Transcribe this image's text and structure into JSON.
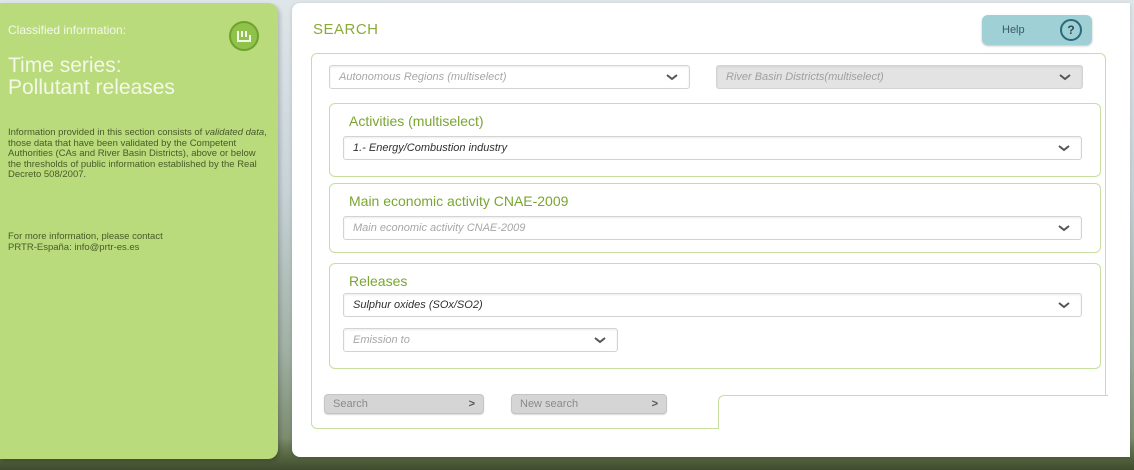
{
  "sidebar": {
    "header": "Classified information:",
    "title_line1": "Time series:",
    "title_line2": "Pollutant releases",
    "info_pre": "Information provided in this section consists of",
    "info_em": "validated data",
    "info_post": ", those data that have been validated by the Competent Authorities (CAs and River Basin Districts), above or below the thresholds of public information established by the Real Decreto 508/2007.",
    "contact_line1": "For more information, please contact",
    "contact_line2": "PRTR-España: info@prtr-es.es"
  },
  "main": {
    "title": "SEARCH",
    "help_label": "Help",
    "help_symbol": "?",
    "regions_placeholder": "Autonomous Regions (multiselect)",
    "basins_placeholder": "River Basin Districts(multiselect)",
    "activities": {
      "title": "Activities (multiselect)",
      "selected": "1.- Energy/Combustion industry"
    },
    "cnae": {
      "title": "Main economic activity CNAE-2009",
      "placeholder": "Main economic activity CNAE-2009"
    },
    "releases": {
      "title": "Releases",
      "selected": "Sulphur oxides (SOx/SO2)",
      "emission_placeholder": "Emission to"
    },
    "buttons": {
      "search": "Search",
      "new_search": "New search",
      "arrow": ">"
    }
  },
  "colors": {
    "sidebar_bg": "#b9db7c",
    "accent_green": "#7aa532",
    "help_bg": "#9ed0d6"
  },
  "icons": [
    "classified-icon",
    "help-icon",
    "chevron-down-icon"
  ]
}
